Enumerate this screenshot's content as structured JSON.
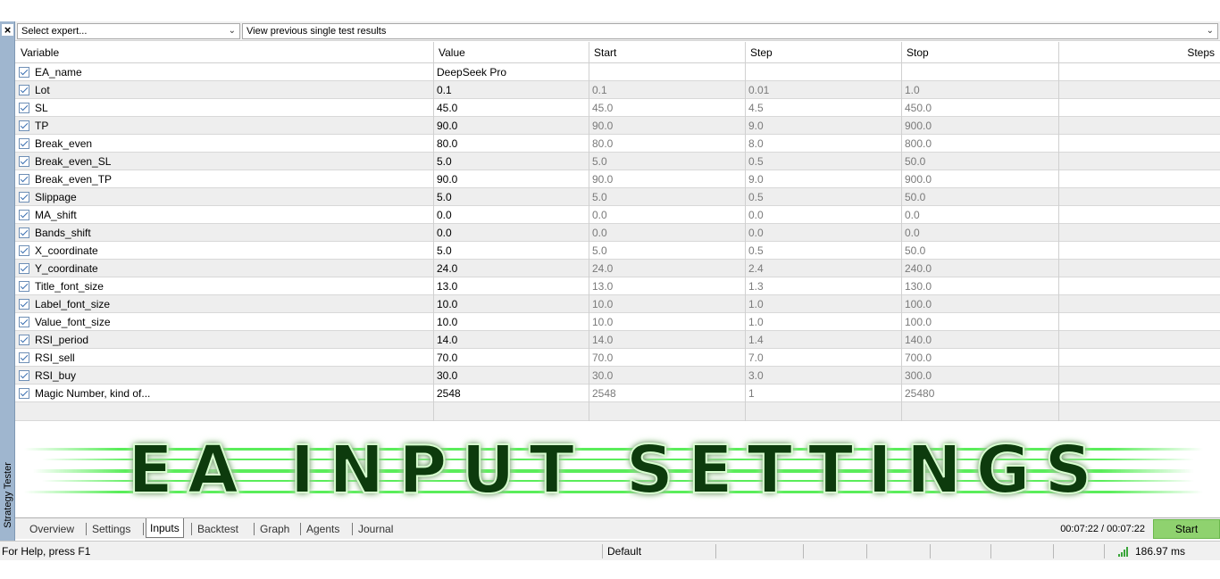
{
  "panel": {
    "close_glyph": "×",
    "label": "Strategy Tester"
  },
  "toolbar": {
    "expert_select": "Select expert...",
    "results_select": "View previous single test results"
  },
  "table": {
    "headers": {
      "variable": "Variable",
      "value": "Value",
      "start": "Start",
      "step": "Step",
      "stop": "Stop",
      "steps": "Steps"
    },
    "rows": [
      {
        "name": "EA_name",
        "value": "DeepSeek Pro",
        "start": "",
        "step": "",
        "stop": ""
      },
      {
        "name": "Lot",
        "value": "0.1",
        "start": "0.1",
        "step": "0.01",
        "stop": "1.0"
      },
      {
        "name": "SL",
        "value": "45.0",
        "start": "45.0",
        "step": "4.5",
        "stop": "450.0"
      },
      {
        "name": "TP",
        "value": "90.0",
        "start": "90.0",
        "step": "9.0",
        "stop": "900.0"
      },
      {
        "name": "Break_even",
        "value": "80.0",
        "start": "80.0",
        "step": "8.0",
        "stop": "800.0"
      },
      {
        "name": "Break_even_SL",
        "value": "5.0",
        "start": "5.0",
        "step": "0.5",
        "stop": "50.0"
      },
      {
        "name": "Break_even_TP",
        "value": "90.0",
        "start": "90.0",
        "step": "9.0",
        "stop": "900.0"
      },
      {
        "name": "Slippage",
        "value": "5.0",
        "start": "5.0",
        "step": "0.5",
        "stop": "50.0"
      },
      {
        "name": "MA_shift",
        "value": "0.0",
        "start": "0.0",
        "step": "0.0",
        "stop": "0.0"
      },
      {
        "name": "Bands_shift",
        "value": "0.0",
        "start": "0.0",
        "step": "0.0",
        "stop": "0.0"
      },
      {
        "name": "X_coordinate",
        "value": "5.0",
        "start": "5.0",
        "step": "0.5",
        "stop": "50.0"
      },
      {
        "name": "Y_coordinate",
        "value": "24.0",
        "start": "24.0",
        "step": "2.4",
        "stop": "240.0"
      },
      {
        "name": "Title_font_size",
        "value": "13.0",
        "start": "13.0",
        "step": "1.3",
        "stop": "130.0"
      },
      {
        "name": "Label_font_size",
        "value": "10.0",
        "start": "10.0",
        "step": "1.0",
        "stop": "100.0"
      },
      {
        "name": "Value_font_size",
        "value": "10.0",
        "start": "10.0",
        "step": "1.0",
        "stop": "100.0"
      },
      {
        "name": "RSI_period",
        "value": "14.0",
        "start": "14.0",
        "step": "1.4",
        "stop": "140.0"
      },
      {
        "name": "RSI_sell",
        "value": "70.0",
        "start": "70.0",
        "step": "7.0",
        "stop": "700.0"
      },
      {
        "name": "RSI_buy",
        "value": "30.0",
        "start": "30.0",
        "step": "3.0",
        "stop": "300.0"
      },
      {
        "name": "Magic Number, kind of...",
        "value": "2548",
        "start": "2548",
        "step": "1",
        "stop": "25480"
      }
    ]
  },
  "banner": {
    "text": "EA INPUT SETTINGS",
    "glow_color": "#19e619",
    "stroke_color": "#d8ffd0"
  },
  "tabs": {
    "items": [
      "Overview",
      "Settings",
      "Inputs",
      "Backtest",
      "Graph",
      "Agents",
      "Journal"
    ],
    "active": "Inputs",
    "timer": "00:07:22 / 00:07:22",
    "start_label": "Start"
  },
  "status": {
    "help": "For Help, press F1",
    "profile": "Default",
    "ping": "186.97 ms",
    "signal_icon": "signal-bars-icon",
    "signal_color": "#3aa53a"
  },
  "colors": {
    "start_button": "#8fd26f",
    "panel": "#9fb6cf"
  }
}
